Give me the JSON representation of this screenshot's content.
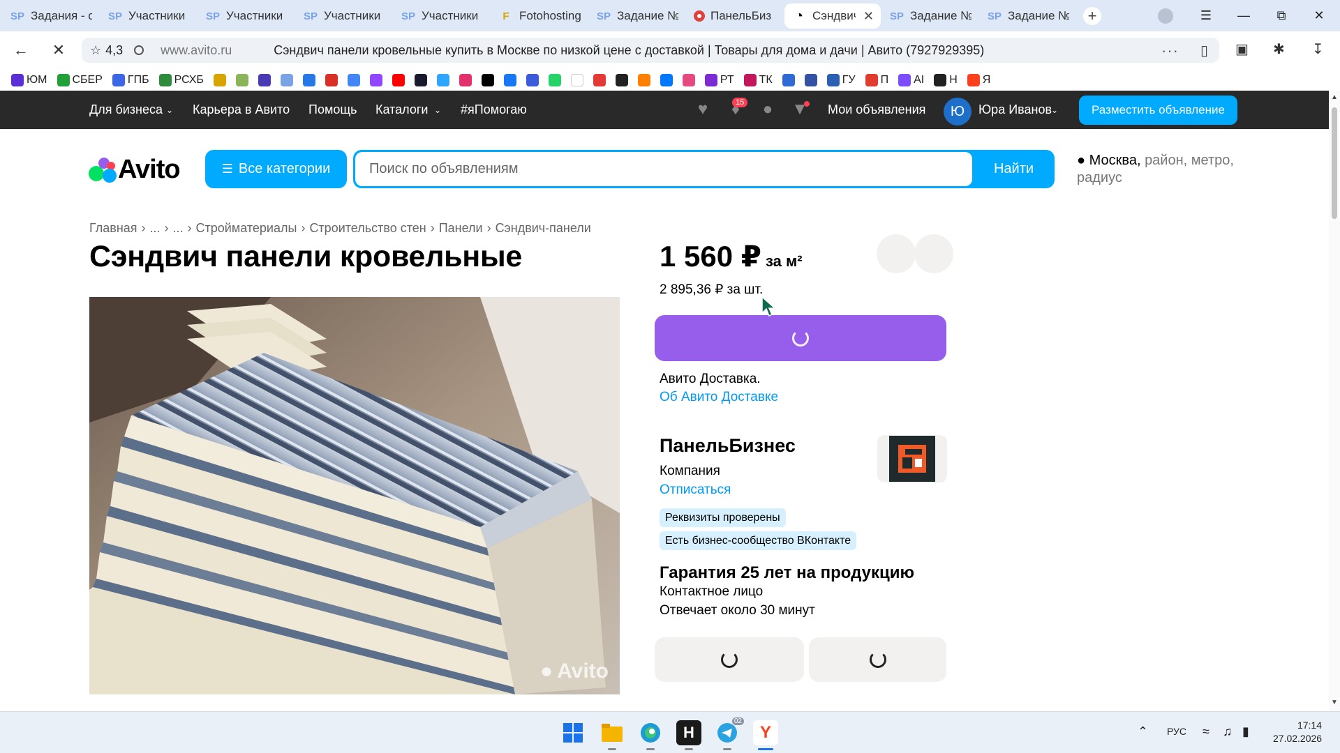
{
  "browser": {
    "tabs": [
      {
        "icon": "sp-icon",
        "label": "Задания - с"
      },
      {
        "icon": "sp-icon",
        "label": "Участники"
      },
      {
        "icon": "sp-icon",
        "label": "Участники"
      },
      {
        "icon": "sp-icon",
        "label": "Участники"
      },
      {
        "icon": "sp-icon",
        "label": "Участники"
      },
      {
        "icon": "fotohosting-icon",
        "label": "Fotohosting"
      },
      {
        "icon": "sp-icon",
        "label": "Задание №"
      },
      {
        "icon": "red-circle-icon",
        "label": "ПанельБиз"
      },
      {
        "icon": "avito-icon",
        "label": "Сэндвич"
      },
      {
        "icon": "sp-icon",
        "label": "Задание №"
      },
      {
        "icon": "sp-icon",
        "label": "Задание №"
      }
    ],
    "active_tab_index": 8,
    "rating": "4,3",
    "domain": "www.avito.ru",
    "page_title": "Сэндвич панели кровельные купить в Москве по низкой цене с доставкой | Товары для дома и дачи | Авито (7927929395)",
    "bookmarks": [
      {
        "label": "ЮМ",
        "color": "#5a2fd6"
      },
      {
        "label": "СБЕР",
        "color": "#21a038"
      },
      {
        "label": "ГПБ",
        "color": "#3c66e6"
      },
      {
        "label": "РСХБ",
        "color": "#2f8a3c"
      },
      {
        "label": "",
        "color": "#d8a400"
      },
      {
        "label": "",
        "color": "#8bb35a"
      },
      {
        "label": "",
        "color": "#4a3bb5"
      },
      {
        "label": "",
        "color": "#7aa3e6"
      },
      {
        "label": "",
        "color": "#2479e6"
      },
      {
        "label": "",
        "color": "#d93025"
      },
      {
        "label": "",
        "color": "#4285f4"
      },
      {
        "label": "",
        "color": "#9146ff"
      },
      {
        "label": "",
        "color": "#ff0000"
      },
      {
        "label": "",
        "color": "#1a1a2e"
      },
      {
        "label": "",
        "color": "#2ea6ff"
      },
      {
        "label": "",
        "color": "#e1306c"
      },
      {
        "label": "",
        "color": "#000000"
      },
      {
        "label": "",
        "color": "#1877f2"
      },
      {
        "label": "",
        "color": "#3b5bdb"
      },
      {
        "label": "",
        "color": "#25d366"
      },
      {
        "label": "",
        "color": "#ffffff"
      },
      {
        "label": "",
        "color": "#e53935"
      },
      {
        "label": "",
        "color": "#222222"
      },
      {
        "label": "",
        "color": "#ff7f00"
      },
      {
        "label": "",
        "color": "#0077ff"
      },
      {
        "label": "",
        "color": "#e64980"
      },
      {
        "label": "РТ",
        "color": "#7a2bd4"
      },
      {
        "label": "ТК",
        "color": "#c2185b"
      },
      {
        "label": "",
        "color": "#2f6bd6"
      },
      {
        "label": "",
        "color": "#3452a3"
      },
      {
        "label": "ГУ",
        "color": "#2b5fb3"
      },
      {
        "label": "П",
        "color": "#e03d2f"
      },
      {
        "label": "AI",
        "color": "#7b4dff"
      },
      {
        "label": "Н",
        "color": "#222222"
      },
      {
        "label": "Я",
        "color": "#fc3f1d"
      }
    ]
  },
  "avito_nav": {
    "links": [
      "Для бизнеса",
      "Карьера в Авито",
      "Помощь",
      "Каталоги",
      "#яПомогаю"
    ],
    "notif_count": "15",
    "my_ads": "Мои объявления",
    "user_initial": "Ю",
    "user_name": "Юра Иванов",
    "post_ad": "Разместить объявление"
  },
  "search": {
    "logo_text": "Avito",
    "all_categories": "Все категории",
    "placeholder": "Поиск по объявлениям",
    "button": "Найти",
    "location_city": "Москва,",
    "location_rest": "район, метро, радиус"
  },
  "breadcrumb": [
    "Главная",
    "...",
    "...",
    "Стройматериалы",
    "Строительство стен",
    "Панели",
    "Сэндвич-панели"
  ],
  "listing": {
    "title": "Сэндвич панели кровельные",
    "photo_watermark": "Avito",
    "price": "1 560 ₽",
    "price_unit": "за м²",
    "price_per_piece": "2 895,36 ₽ за шт.",
    "delivery_title": "Авито Доставка.",
    "delivery_link": "Об Авито Доставке"
  },
  "seller": {
    "name": "ПанельБизнес",
    "type": "Компания",
    "unsubscribe": "Отписаться",
    "badges": [
      "Реквизиты проверены",
      "Есть бизнес-сообщество ВКонтакте"
    ],
    "guarantee": "Гарантия 25 лет на продукцию",
    "contact": "Контактное лицо",
    "response_time": "Отвечает около 30 минут"
  },
  "taskbar": {
    "telegram_badge": "02",
    "lang": "РУС",
    "time": "17:14",
    "date": "27.02.2026"
  },
  "colors": {
    "avito_blue": "#00aaff",
    "buy_purple": "#965eeb",
    "link_blue": "#0099f7",
    "nav_dark": "#292929"
  }
}
